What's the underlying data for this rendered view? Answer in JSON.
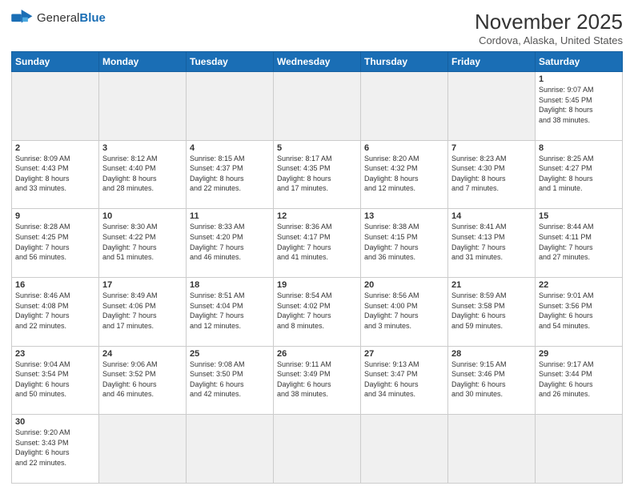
{
  "header": {
    "logo_general": "General",
    "logo_blue": "Blue",
    "title": "November 2025",
    "subtitle": "Cordova, Alaska, United States"
  },
  "weekdays": [
    "Sunday",
    "Monday",
    "Tuesday",
    "Wednesday",
    "Thursday",
    "Friday",
    "Saturday"
  ],
  "weeks": [
    [
      {
        "day": "",
        "info": "",
        "empty": true
      },
      {
        "day": "",
        "info": "",
        "empty": true
      },
      {
        "day": "",
        "info": "",
        "empty": true
      },
      {
        "day": "",
        "info": "",
        "empty": true
      },
      {
        "day": "",
        "info": "",
        "empty": true
      },
      {
        "day": "",
        "info": "",
        "empty": true
      },
      {
        "day": "1",
        "info": "Sunrise: 9:07 AM\nSunset: 5:45 PM\nDaylight: 8 hours\nand 38 minutes."
      }
    ],
    [
      {
        "day": "2",
        "info": "Sunrise: 8:09 AM\nSunset: 4:43 PM\nDaylight: 8 hours\nand 33 minutes."
      },
      {
        "day": "3",
        "info": "Sunrise: 8:12 AM\nSunset: 4:40 PM\nDaylight: 8 hours\nand 28 minutes."
      },
      {
        "day": "4",
        "info": "Sunrise: 8:15 AM\nSunset: 4:37 PM\nDaylight: 8 hours\nand 22 minutes."
      },
      {
        "day": "5",
        "info": "Sunrise: 8:17 AM\nSunset: 4:35 PM\nDaylight: 8 hours\nand 17 minutes."
      },
      {
        "day": "6",
        "info": "Sunrise: 8:20 AM\nSunset: 4:32 PM\nDaylight: 8 hours\nand 12 minutes."
      },
      {
        "day": "7",
        "info": "Sunrise: 8:23 AM\nSunset: 4:30 PM\nDaylight: 8 hours\nand 7 minutes."
      },
      {
        "day": "8",
        "info": "Sunrise: 8:25 AM\nSunset: 4:27 PM\nDaylight: 8 hours\nand 1 minute."
      }
    ],
    [
      {
        "day": "9",
        "info": "Sunrise: 8:28 AM\nSunset: 4:25 PM\nDaylight: 7 hours\nand 56 minutes."
      },
      {
        "day": "10",
        "info": "Sunrise: 8:30 AM\nSunset: 4:22 PM\nDaylight: 7 hours\nand 51 minutes."
      },
      {
        "day": "11",
        "info": "Sunrise: 8:33 AM\nSunset: 4:20 PM\nDaylight: 7 hours\nand 46 minutes."
      },
      {
        "day": "12",
        "info": "Sunrise: 8:36 AM\nSunset: 4:17 PM\nDaylight: 7 hours\nand 41 minutes."
      },
      {
        "day": "13",
        "info": "Sunrise: 8:38 AM\nSunset: 4:15 PM\nDaylight: 7 hours\nand 36 minutes."
      },
      {
        "day": "14",
        "info": "Sunrise: 8:41 AM\nSunset: 4:13 PM\nDaylight: 7 hours\nand 31 minutes."
      },
      {
        "day": "15",
        "info": "Sunrise: 8:44 AM\nSunset: 4:11 PM\nDaylight: 7 hours\nand 27 minutes."
      }
    ],
    [
      {
        "day": "16",
        "info": "Sunrise: 8:46 AM\nSunset: 4:08 PM\nDaylight: 7 hours\nand 22 minutes."
      },
      {
        "day": "17",
        "info": "Sunrise: 8:49 AM\nSunset: 4:06 PM\nDaylight: 7 hours\nand 17 minutes."
      },
      {
        "day": "18",
        "info": "Sunrise: 8:51 AM\nSunset: 4:04 PM\nDaylight: 7 hours\nand 12 minutes."
      },
      {
        "day": "19",
        "info": "Sunrise: 8:54 AM\nSunset: 4:02 PM\nDaylight: 7 hours\nand 8 minutes."
      },
      {
        "day": "20",
        "info": "Sunrise: 8:56 AM\nSunset: 4:00 PM\nDaylight: 7 hours\nand 3 minutes."
      },
      {
        "day": "21",
        "info": "Sunrise: 8:59 AM\nSunset: 3:58 PM\nDaylight: 6 hours\nand 59 minutes."
      },
      {
        "day": "22",
        "info": "Sunrise: 9:01 AM\nSunset: 3:56 PM\nDaylight: 6 hours\nand 54 minutes."
      }
    ],
    [
      {
        "day": "23",
        "info": "Sunrise: 9:04 AM\nSunset: 3:54 PM\nDaylight: 6 hours\nand 50 minutes."
      },
      {
        "day": "24",
        "info": "Sunrise: 9:06 AM\nSunset: 3:52 PM\nDaylight: 6 hours\nand 46 minutes."
      },
      {
        "day": "25",
        "info": "Sunrise: 9:08 AM\nSunset: 3:50 PM\nDaylight: 6 hours\nand 42 minutes."
      },
      {
        "day": "26",
        "info": "Sunrise: 9:11 AM\nSunset: 3:49 PM\nDaylight: 6 hours\nand 38 minutes."
      },
      {
        "day": "27",
        "info": "Sunrise: 9:13 AM\nSunset: 3:47 PM\nDaylight: 6 hours\nand 34 minutes."
      },
      {
        "day": "28",
        "info": "Sunrise: 9:15 AM\nSunset: 3:46 PM\nDaylight: 6 hours\nand 30 minutes."
      },
      {
        "day": "29",
        "info": "Sunrise: 9:17 AM\nSunset: 3:44 PM\nDaylight: 6 hours\nand 26 minutes."
      }
    ],
    [
      {
        "day": "30",
        "info": "Sunrise: 9:20 AM\nSunset: 3:43 PM\nDaylight: 6 hours\nand 22 minutes."
      },
      {
        "day": "",
        "info": "",
        "empty": true
      },
      {
        "day": "",
        "info": "",
        "empty": true
      },
      {
        "day": "",
        "info": "",
        "empty": true
      },
      {
        "day": "",
        "info": "",
        "empty": true
      },
      {
        "day": "",
        "info": "",
        "empty": true
      },
      {
        "day": "",
        "info": "",
        "empty": true
      }
    ]
  ]
}
